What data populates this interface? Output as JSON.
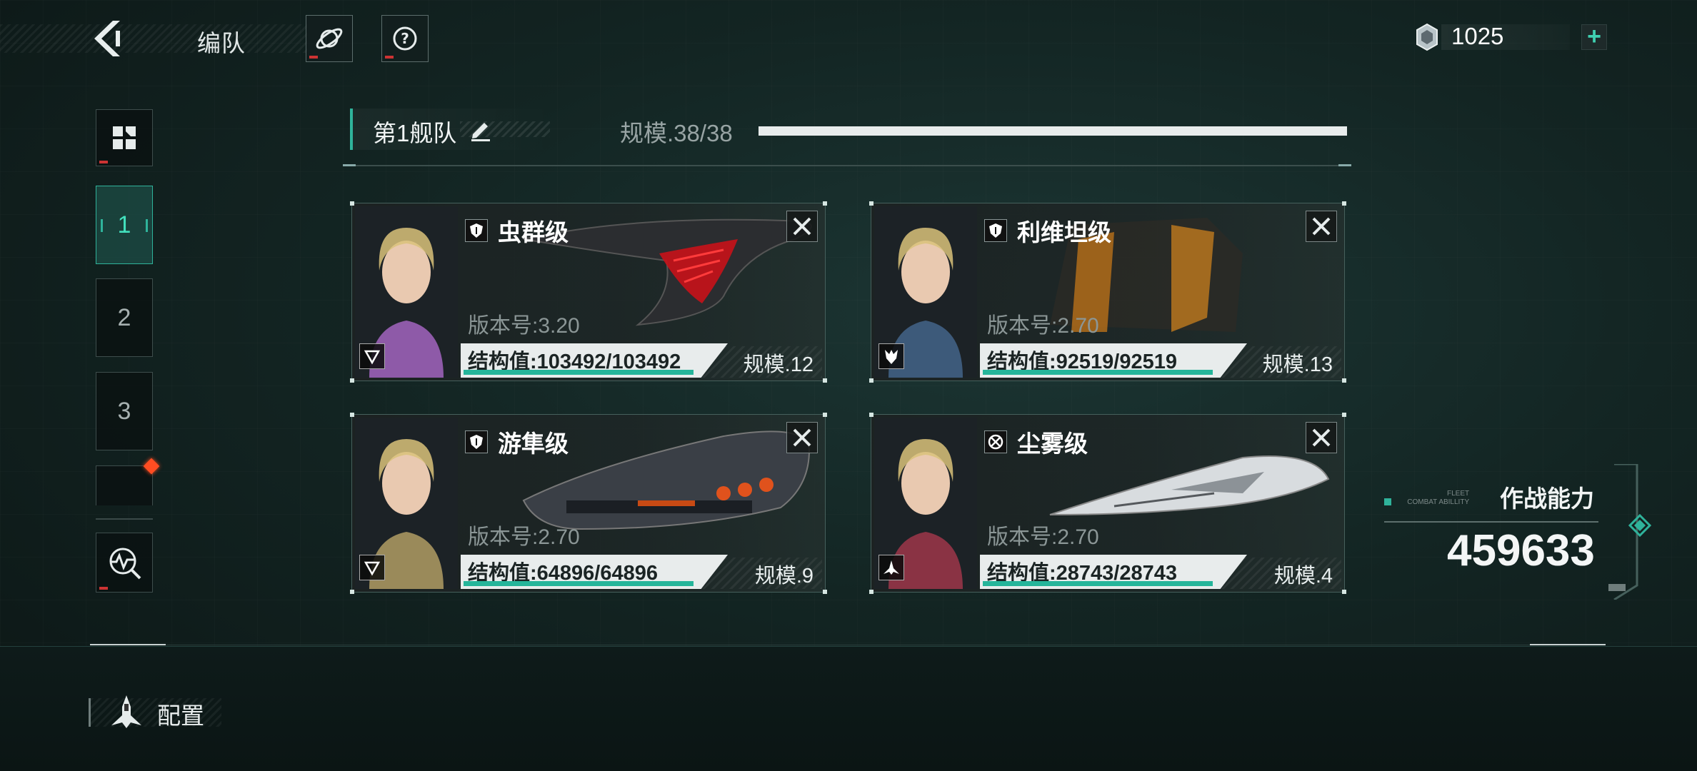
{
  "header": {
    "title": "编队",
    "planet_button_icon": "planet-icon",
    "help_button_icon": "help-icon",
    "currency": {
      "icon": "crystal-icon",
      "value": "1025",
      "add_label": "+"
    }
  },
  "sidebar": {
    "items": [
      {
        "type": "icon",
        "icon": "grid-icon"
      },
      {
        "type": "tab",
        "label": "1",
        "active": true
      },
      {
        "type": "tab",
        "label": "2",
        "active": false
      },
      {
        "type": "tab",
        "label": "3",
        "active": false
      },
      {
        "type": "tab",
        "label": "",
        "active": false,
        "notification": true
      },
      {
        "type": "icon",
        "icon": "scan-icon"
      }
    ]
  },
  "fleet": {
    "name": "第1舰队",
    "scale_label": "规模.38/38",
    "scale_fill": 1.0
  },
  "ships": [
    {
      "name": "虫群级",
      "class_icon": "shield-icon",
      "version": "版本号:3.20",
      "structure": "结构值:103492/103492",
      "structure_fill": 1.0,
      "scale": "规模.12",
      "badge_icon": "triangle-down-icon",
      "portrait_color": "#8e5aa8"
    },
    {
      "name": "利维坦级",
      "class_icon": "shield-icon",
      "version": "版本号:2.70",
      "structure": "结构值:92519/92519",
      "structure_fill": 1.0,
      "scale": "规模.13",
      "badge_icon": "wolf-emblem-icon",
      "portrait_color": "#3d5a7a"
    },
    {
      "name": "游隼级",
      "class_icon": "shield-icon",
      "version": "版本号:2.70",
      "structure": "结构值:64896/64896",
      "structure_fill": 1.0,
      "scale": "规模.9",
      "badge_icon": "triangle-down-icon",
      "portrait_color": "#9a8a5a"
    },
    {
      "name": "尘雾级",
      "class_icon": "crosshair-icon",
      "version": "版本号:2.70",
      "structure": "结构值:28743/28743",
      "structure_fill": 1.0,
      "scale": "规模.4",
      "badge_icon": "fighter-wing-icon",
      "portrait_color": "#8a3344"
    }
  ],
  "combat": {
    "title": "作战能力",
    "subtitle_line1": "FLEET",
    "subtitle_line2": "COMBAT ABILLITY",
    "value": "459633"
  },
  "config": {
    "label": "配置",
    "icon": "ship-config-icon"
  },
  "colors": {
    "accent": "#2fb39b",
    "bar_fill": "#25b59a",
    "alert": "#ff4d22"
  }
}
